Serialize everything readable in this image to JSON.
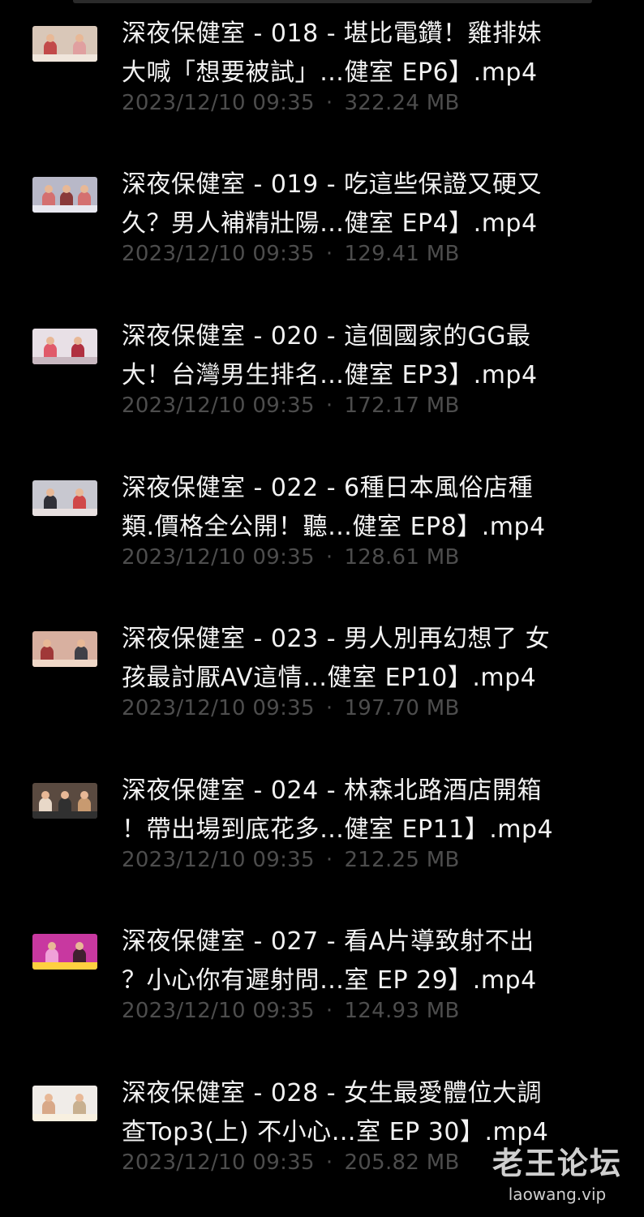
{
  "files": [
    {
      "title_line1": "深夜保健室 - 018 - 堪比電鑽！雞排妹",
      "title_line2": "大喊「想要被試」…健室 EP6】.mp4",
      "date": "2023/12/10 09:35",
      "size": "322.24 MB",
      "thumb_colors": [
        "#d9c7b8",
        "#c24a4a",
        "#f0e6dc",
        "#e0a0a0"
      ]
    },
    {
      "title_line1": "深夜保健室 - 019 - 吃這些保證又硬又",
      "title_line2": "久？男人補精壯陽…健室 EP4】.mp4",
      "date": "2023/12/10 09:35",
      "size": "129.41 MB",
      "thumb_colors": [
        "#b8b8c8",
        "#8a3a3a",
        "#e8e8f0",
        "#d47070"
      ]
    },
    {
      "title_line1": "深夜保健室 - 020 - 這個國家的GG最",
      "title_line2": "大！台灣男生排名…健室 EP3】.mp4",
      "date": "2023/12/10 09:35",
      "size": "172.17 MB",
      "thumb_colors": [
        "#e8e0e6",
        "#b03040",
        "#c8b8c0",
        "#e05a6a"
      ]
    },
    {
      "title_line1": "深夜保健室 - 022 - 6種日本風俗店種",
      "title_line2": "類.價格全公開！聽…健室 EP8】.mp4",
      "date": "2023/12/10 09:35",
      "size": "128.61 MB",
      "thumb_colors": [
        "#c8c8d0",
        "#303038",
        "#e8e0e0",
        "#d04848"
      ]
    },
    {
      "title_line1": "深夜保健室 - 023 - 男人別再幻想了 女",
      "title_line2": "孩最討厭AV這情…健室 EP10】.mp4",
      "date": "2023/12/10 09:35",
      "size": "197.70 MB",
      "thumb_colors": [
        "#d8b0a0",
        "#a03838",
        "#f0d8c8",
        "#404048"
      ]
    },
    {
      "title_line1": "深夜保健室 - 024 - 林森北路酒店開箱",
      "title_line2": "！帶出場到底花多…健室 EP11】.mp4",
      "date": "2023/12/10 09:35",
      "size": "212.25 MB",
      "thumb_colors": [
        "#5a4a40",
        "#e8d8c8",
        "#303030",
        "#c89a70"
      ]
    },
    {
      "title_line1": "深夜保健室 - 027 - 看A片導致射不出",
      "title_line2": "？小心你有遲射問…室 EP 29】.mp4",
      "date": "2023/12/10 09:35",
      "size": "124.93 MB",
      "thumb_colors": [
        "#c838a0",
        "#f0a0d8",
        "#ffd040",
        "#402030"
      ]
    },
    {
      "title_line1": "深夜保健室 - 028 - 女生最愛體位大調",
      "title_line2": "查Top3(上) 不小心…室 EP 30】.mp4",
      "date": "2023/12/10 09:35",
      "size": "205.82 MB",
      "thumb_colors": [
        "#f0ece8",
        "#d8a888",
        "#f8f0e0",
        "#c8b090"
      ]
    }
  ],
  "meta_separator": "·",
  "watermark": {
    "title": "老王论坛",
    "url": "laowang.vip"
  }
}
